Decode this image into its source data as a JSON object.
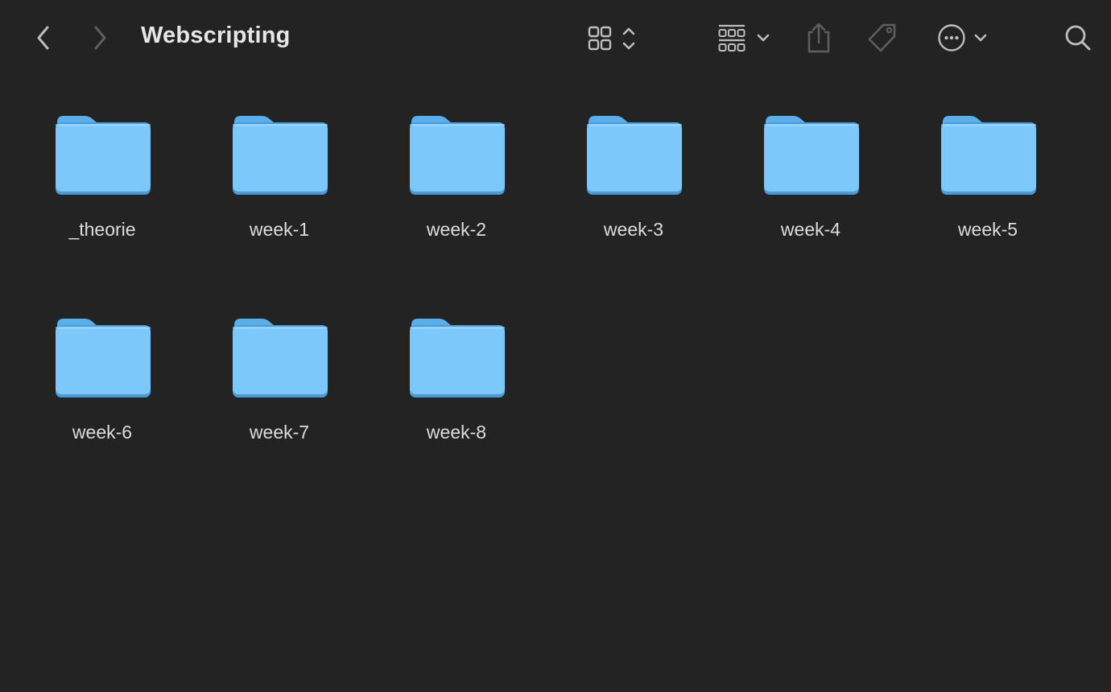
{
  "window": {
    "title": "Webscripting",
    "background": "#232323"
  },
  "toolbar": {
    "back_icon": "chevron-left-icon",
    "forward_icon": "chevron-right-icon",
    "view_icon": "grid-view-icon",
    "view_toggle_icon": "up-down-chevron-icon",
    "group_icon": "group-by-icon",
    "share_icon": "share-icon",
    "tag_icon": "tag-icon",
    "more_icon": "ellipsis-circle-icon",
    "search_icon": "search-icon"
  },
  "folders": [
    {
      "name": "_theorie"
    },
    {
      "name": "week-1"
    },
    {
      "name": "week-2"
    },
    {
      "name": "week-3"
    },
    {
      "name": "week-4"
    },
    {
      "name": "week-5"
    },
    {
      "name": "week-6"
    },
    {
      "name": "week-7"
    },
    {
      "name": "week-8"
    }
  ],
  "colors": {
    "folder_front": "#7cc8fb",
    "folder_back": "#5aaee9",
    "folder_shadow": "#4b9ad6",
    "icon_active": "#bdbdbd",
    "icon_disabled": "#5e5e5e"
  }
}
